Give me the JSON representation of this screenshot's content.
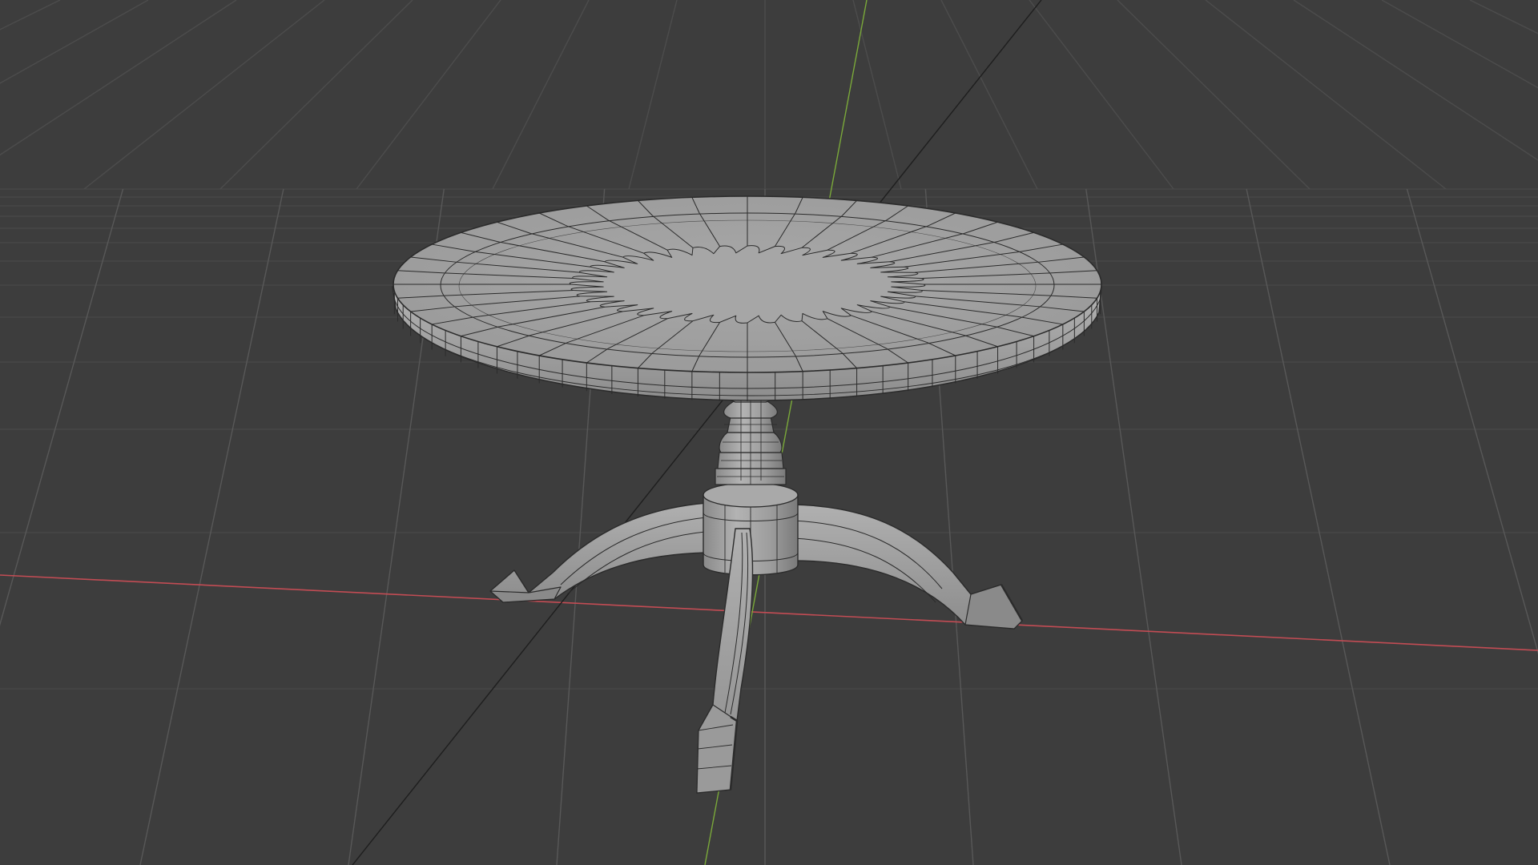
{
  "viewport": {
    "background": "#3d3d3d",
    "grid_line_color": "#545454",
    "x_axis_color": "#c24c54",
    "y_axis_color": "#7aa83a",
    "view_line_color": "#1e1e1e"
  },
  "model": {
    "object": "round-pedestal-table",
    "display_mode": "solid-with-wireframe",
    "surface_color": "#a3a3a3",
    "wire_color": "#2b2b2b",
    "top_segments": 40,
    "legs": 3
  }
}
